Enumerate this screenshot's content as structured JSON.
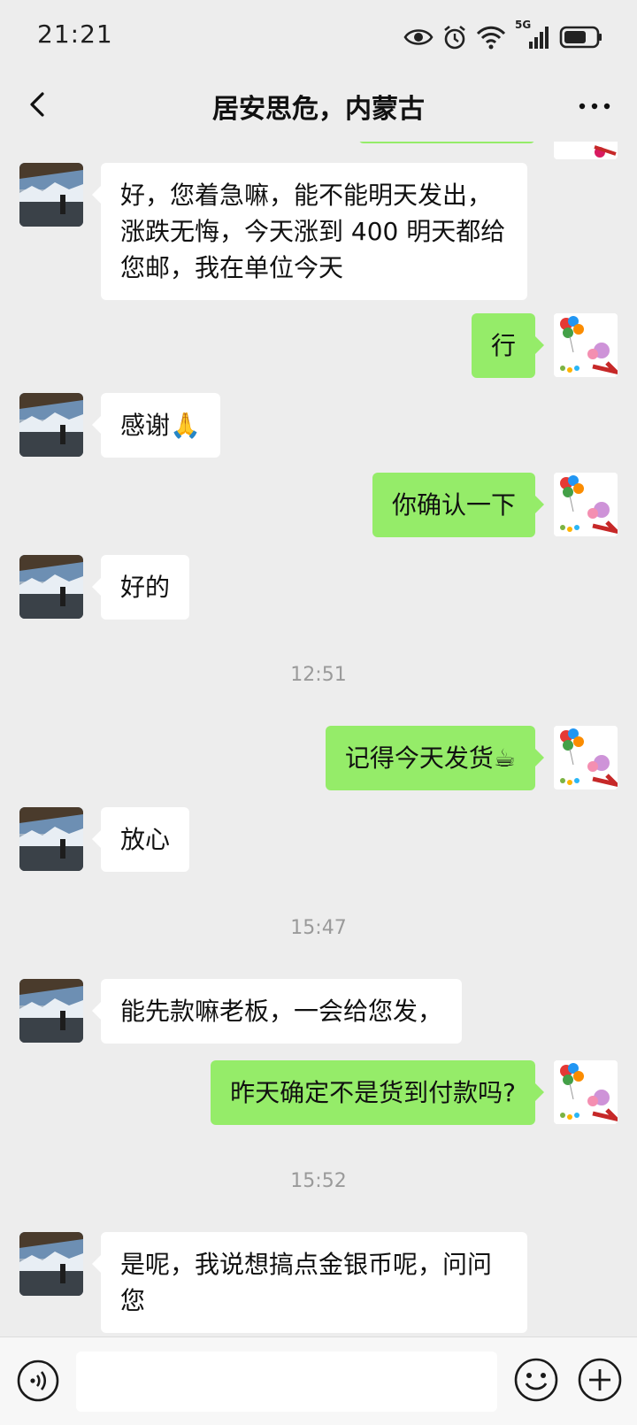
{
  "status_bar": {
    "time": "21:21",
    "network_label": "5G",
    "icons": [
      "eye-icon",
      "alarm-icon",
      "wifi-icon",
      "signal-icon",
      "battery-icon"
    ]
  },
  "header": {
    "title": "居安思危，内蒙古",
    "back_icon": "chevron-left-icon",
    "more_icon": "more-dots-icon"
  },
  "colors": {
    "background": "#ededed",
    "incoming_bubble": "#ffffff",
    "outgoing_bubble": "#95ec69",
    "timestamp_text": "#9a9a9a"
  },
  "messages": [
    {
      "from": "them",
      "text": "好，您着急嘛，能不能明天发出，涨跌无悔，今天涨到 400 明天都给您邮，我在单位今天"
    },
    {
      "from": "me",
      "text": "行"
    },
    {
      "from": "them",
      "text": "感谢🙏"
    },
    {
      "from": "me",
      "text": "你确认一下"
    },
    {
      "from": "them",
      "text": "好的"
    },
    {
      "timestamp": "12:51"
    },
    {
      "from": "me",
      "text": "记得今天发货☕"
    },
    {
      "from": "them",
      "text": "放心"
    },
    {
      "timestamp": "15:47"
    },
    {
      "from": "them",
      "text": "能先款嘛老板，一会给您发，"
    },
    {
      "from": "me",
      "text": "昨天确定不是货到付款吗?"
    },
    {
      "timestamp": "15:52"
    },
    {
      "from": "them",
      "text": "是呢，我说想搞点金银币呢，问问您"
    }
  ],
  "input_bar": {
    "voice_icon": "voice-icon",
    "input_value": "",
    "emoji_icon": "emoji-icon",
    "plus_icon": "plus-icon"
  }
}
